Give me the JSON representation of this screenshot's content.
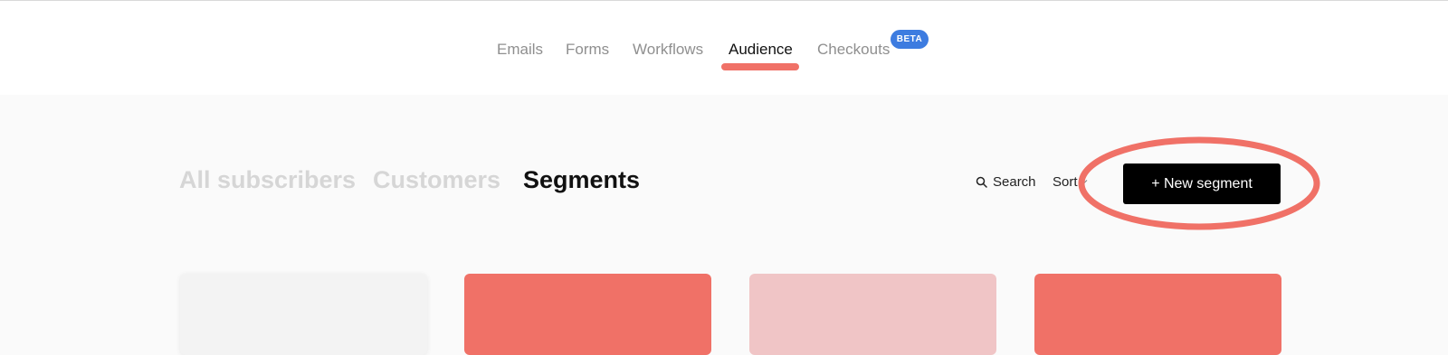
{
  "nav": {
    "items": [
      {
        "label": "Emails"
      },
      {
        "label": "Forms"
      },
      {
        "label": "Workflows"
      },
      {
        "label": "Audience"
      },
      {
        "label": "Checkouts"
      }
    ],
    "active": "Audience",
    "beta_label": "BETA"
  },
  "tabs": [
    {
      "label": "All subscribers"
    },
    {
      "label": "Customers"
    },
    {
      "label": "Segments"
    }
  ],
  "toolbar": {
    "search_label": "Search",
    "sort_label": "Sort",
    "new_segment_label": "+ New segment"
  },
  "cards": [
    {
      "color": "#f3f3f3"
    },
    {
      "color": "#f07167"
    },
    {
      "color": "#f0c5c6"
    },
    {
      "color": "#f07167"
    }
  ],
  "colors": {
    "accent": "#f07167",
    "beta_badge": "#3d7ce0",
    "primary_button": "#000000",
    "annotation": "#f07167"
  }
}
